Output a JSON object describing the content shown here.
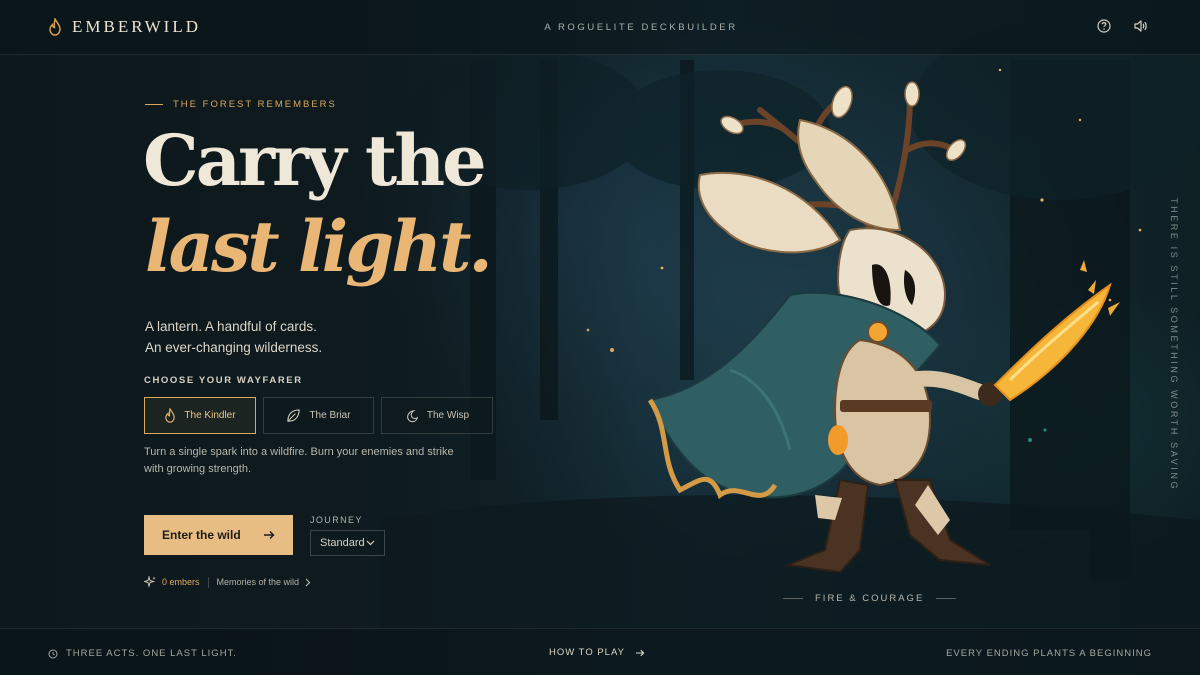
{
  "brand": {
    "name": "EMBERWILD",
    "icon": "flame-icon"
  },
  "header": {
    "tagline": "A ROGUELITE DECKBUILDER",
    "icons": [
      "help-icon",
      "sound-icon"
    ]
  },
  "hero": {
    "eyebrow": "THE FOREST REMEMBERS",
    "headline_line1": "Carry the",
    "headline_line2": "last light.",
    "lead_line1": "A lantern. A handful of cards.",
    "lead_line2": "An ever-changing wilderness."
  },
  "wayfarer_section": {
    "label": "CHOOSE YOUR WAYFARER",
    "options": [
      {
        "label": "The Kindler",
        "icon": "flame-icon",
        "selected": true
      },
      {
        "label": "The Briar",
        "icon": "leaf-icon",
        "selected": false
      },
      {
        "label": "The Wisp",
        "icon": "moon-icon",
        "selected": false
      }
    ],
    "description": "Turn a single spark into a wildfire. Burn your enemies and strike with growing strength."
  },
  "actions": {
    "cta_label": "Enter the wild",
    "journey_label": "JOURNEY",
    "journey_value": "Standard",
    "embers": "0 embers",
    "memories": "Memories of the wild"
  },
  "character_caption": "FIRE & COURAGE",
  "side_text": "THERE IS STILL SOMETHING WORTH SAVING",
  "footer": {
    "left": "THREE ACTS. ONE LAST LIGHT.",
    "center": "HOW TO PLAY",
    "right": "EVERY ENDING PLANTS A BEGINNING"
  },
  "colors": {
    "accent": "#e8bd83",
    "background": "#0d1a1e",
    "text": "#efe8d8"
  }
}
